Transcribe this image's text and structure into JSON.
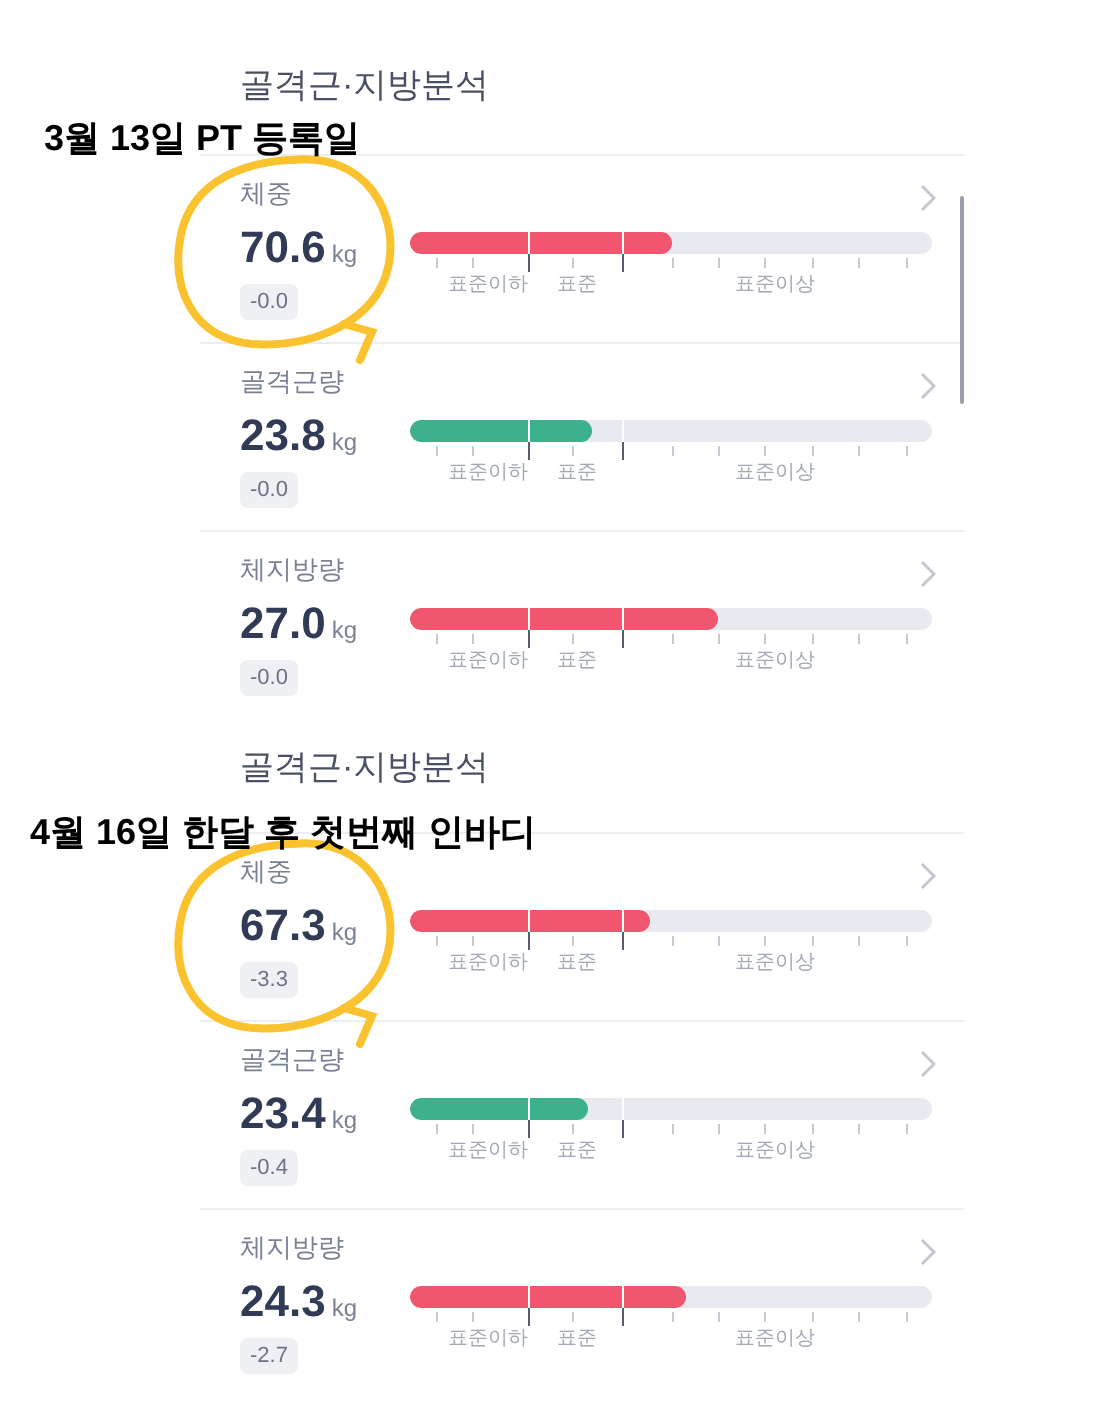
{
  "sections": [
    {
      "title": "골격근·지방분석",
      "annotation": "3월 13일 PT 등록일",
      "rows": [
        {
          "label": "체중",
          "value": "70.6",
          "unit": "kg",
          "change": "-0.0",
          "level": 0.5,
          "color": "#f0566e",
          "scale_labels": [
            "표준이하",
            "표준",
            "표준이상"
          ]
        },
        {
          "label": "골격근량",
          "value": "23.8",
          "unit": "kg",
          "change": "-0.0",
          "level": 0.35,
          "color": "#3db08e",
          "scale_labels": [
            "표준이하",
            "표준",
            "표준이상"
          ]
        },
        {
          "label": "체지방량",
          "value": "27.0",
          "unit": "kg",
          "change": "-0.0",
          "level": 0.59,
          "color": "#f0566e",
          "scale_labels": [
            "표준이하",
            "표준",
            "표준이상"
          ]
        }
      ]
    },
    {
      "title": "골격근·지방분석",
      "annotation": "4월 16일 한달 후 첫번째 인바디",
      "rows": [
        {
          "label": "체중",
          "value": "67.3",
          "unit": "kg",
          "change": "-3.3",
          "level": 0.46,
          "color": "#f0566e",
          "scale_labels": [
            "표준이하",
            "표준",
            "표준이상"
          ]
        },
        {
          "label": "골격근량",
          "value": "23.4",
          "unit": "kg",
          "change": "-0.4",
          "level": 0.34,
          "color": "#3db08e",
          "scale_labels": [
            "표준이하",
            "표준",
            "표준이상"
          ]
        },
        {
          "label": "체지방량",
          "value": "24.3",
          "unit": "kg",
          "change": "-2.7",
          "level": 0.53,
          "color": "#f0566e",
          "scale_labels": [
            "표준이하",
            "표준",
            "표준이상"
          ]
        }
      ]
    }
  ]
}
